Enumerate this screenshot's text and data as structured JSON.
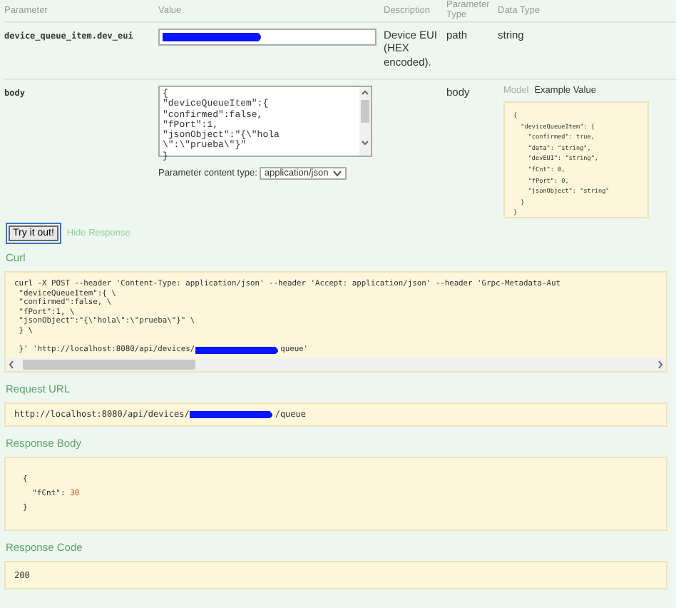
{
  "parameters_table": {
    "columns": [
      "Parameter",
      "Value",
      "Description",
      "Parameter Type",
      "Data Type"
    ],
    "rows": [
      {
        "kind": "text",
        "name": "device_queue_item.dev_eui",
        "value_redacted": true,
        "description": "Device EUI (HEX encoded).",
        "parameter_type": "path",
        "data_type": "string"
      },
      {
        "kind": "body",
        "name": "body",
        "value": "{\n\"deviceQueueItem\":{\n\"confirmed\":false,\n\"fPort\":1,\n\"jsonObject\":\"{\\\"hola\n\\\":\\\"prueba\\\"}\"\n}",
        "content_type_label": "Parameter content type:",
        "content_type": "application/json",
        "parameter_type": "body",
        "data_tabs": [
          {
            "label": "Model",
            "selected": false
          },
          {
            "label": "Example Value",
            "selected": true
          }
        ],
        "example_value": "{\n  \"deviceQueueItem\": {\n    \"confirmed\": true,\n    \"data\": \"string\",\n    \"devEUI\": \"string\",\n    \"fCnt\": 0,\n    \"fPort\": 0,\n    \"jsonObject\": \"string\"\n  }\n}"
      }
    ]
  },
  "try_button": "Try it out!",
  "hide_link": "Hide Response",
  "curl": {
    "label": "Curl",
    "lines": [
      "curl -X POST --header 'Content-Type: application/json' --header 'Accept: application/json' --header 'Grpc-Metadata-Aut",
      " \"deviceQueueItem\":{ \\",
      " \"confirmed\":false, \\",
      " \"fPort\":1, \\",
      " \"jsonObject\":\"{\\\"hola\\\":\\\"prueba\\\"}\" \\",
      " } \\"
    ],
    "last_line": {
      "before": " }' 'http://localhost:8080/api/devices/",
      "redacted": true,
      "after": "queue'"
    }
  },
  "request_url": {
    "label": "Request URL",
    "before": "http://localhost:8080/api/devices/",
    "redacted": true,
    "after": "/queue"
  },
  "response_body": {
    "label": "Response Body",
    "open": "{",
    "key": "  \"fCnt\": ",
    "number": "30",
    "close": "}"
  },
  "response_code": {
    "label": "Response Code",
    "value": "200"
  }
}
